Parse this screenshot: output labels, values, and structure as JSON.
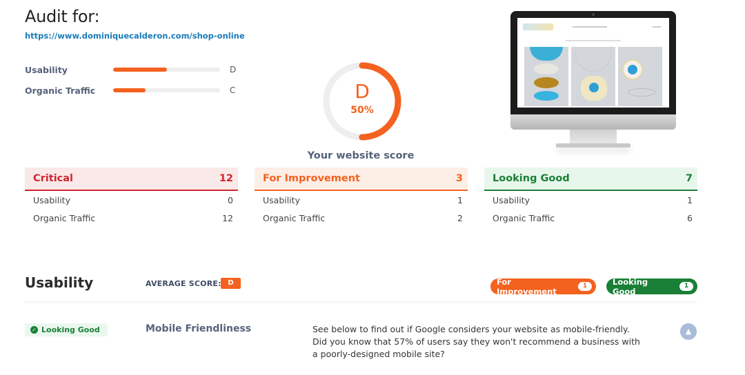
{
  "header": {
    "title": "Audit for:",
    "url": "https://www.dominiquecalderon.com/shop-online"
  },
  "categories": [
    {
      "label": "Usability",
      "grade": "D",
      "progress_percent": 50
    },
    {
      "label": "Organic Traffic",
      "grade": "C",
      "progress_percent": 30
    }
  ],
  "score": {
    "grade": "D",
    "percent_text": "50%",
    "percent": 50,
    "label": "Your website score"
  },
  "preview": {
    "icon": "monitor-preview-icon"
  },
  "status_cards": [
    {
      "title": "Critical",
      "total": "12",
      "color": "#d0262f",
      "rows": [
        {
          "label": "Usability",
          "value": "0"
        },
        {
          "label": "Organic Traffic",
          "value": "12"
        }
      ]
    },
    {
      "title": "For Improvement",
      "total": "3",
      "color": "#f4621f",
      "rows": [
        {
          "label": "Usability",
          "value": "1"
        },
        {
          "label": "Organic Traffic",
          "value": "2"
        }
      ]
    },
    {
      "title": "Looking Good",
      "total": "7",
      "color": "#1a7f37",
      "rows": [
        {
          "label": "Usability",
          "value": "1"
        },
        {
          "label": "Organic Traffic",
          "value": "6"
        }
      ]
    }
  ],
  "section": {
    "title": "Usability",
    "average_label": "AVERAGE SCORE:",
    "average_grade": "D",
    "filters": [
      {
        "label": "For Improvement",
        "count": "1"
      },
      {
        "label": "Looking Good",
        "count": "1"
      }
    ]
  },
  "check": {
    "status": "Looking Good",
    "status_icon": "check-circle-icon",
    "name": "Mobile Friendliness",
    "description": "See below to find out if Google considers your website as mobile-friendly. Did you know that 57% of users say they won't recommend a business with a poorly-designed mobile site?",
    "toggle_icon": "chevron-up-icon"
  },
  "colors": {
    "accent_orange": "#f4621f",
    "critical_red": "#d0262f",
    "good_green": "#1a7f37",
    "link_blue": "#1a7bb9"
  }
}
